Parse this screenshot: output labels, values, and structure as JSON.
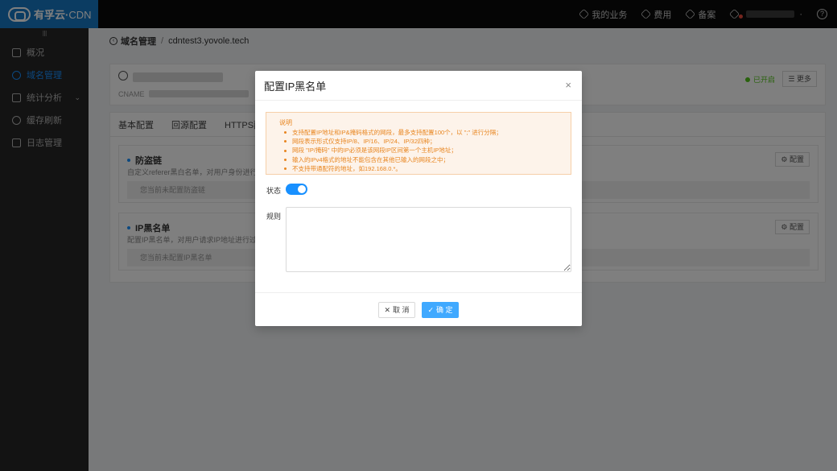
{
  "app": {
    "logo_brand": "有孚云",
    "logo_sep": "·",
    "logo_product": "CDN"
  },
  "topnav": {
    "items": [
      {
        "label": "我的业务",
        "icon": "business-icon"
      },
      {
        "label": "费用",
        "icon": "fee-icon"
      },
      {
        "label": "备案",
        "icon": "record-icon"
      }
    ],
    "help_glyph": "?",
    "user_caret": "·"
  },
  "sidebar": {
    "handle": "III",
    "items": [
      {
        "label": "概况",
        "icon": "overview-icon",
        "active": false
      },
      {
        "label": "域名管理",
        "icon": "domain-icon",
        "active": true
      },
      {
        "label": "统计分析",
        "icon": "stats-icon",
        "active": false,
        "caret": "⌄"
      },
      {
        "label": "缓存刷新",
        "icon": "refresh-icon",
        "active": false
      },
      {
        "label": "日志管理",
        "icon": "log-icon",
        "active": false
      }
    ]
  },
  "breadcrumb": {
    "back_glyph": "‹",
    "parent": "域名管理",
    "separator": "/",
    "current": "cdntest3.yovole.tech"
  },
  "domain_card": {
    "cname_label": "CNAME",
    "status": "已开启",
    "more_label": "☰ 更多"
  },
  "tabs": [
    "基本配置",
    "回源配置",
    "HTTPS配"
  ],
  "sections": [
    {
      "title": "防盗链",
      "desc": "自定义referer黑白名单，对用户身份进行识别",
      "empty": "您当前未配置防盗链",
      "config_label": "⚙ 配置"
    },
    {
      "title": "IP黑名单",
      "desc": "配置IP黑名单，对用户请求IP地址进行过滤。",
      "empty": "您当前未配置IP黑名单",
      "config_label": "⚙ 配置"
    }
  ],
  "modal": {
    "title": "配置IP黑名单",
    "close_glyph": "×",
    "notice_title": "说明",
    "notice_items": [
      "支持配置IP地址和IP&掩码格式的网段，最多支持配置100个，以 \";\" 进行分隔；",
      "网段表示形式仅支持IP/8、IP/16、IP/24、IP/32四种；",
      "网段 \"IP/掩码\" 中的IP必须是该网段IP区间第一个主机IP地址；",
      "输入的IPv4格式的地址不能包含在其他已输入的网段之中；",
      "不支持带通配符的地址，如192.168.0.*。"
    ],
    "status_label": "状态",
    "status_on": true,
    "rule_label": "规则",
    "rule_value": "",
    "cancel_label": "取 消",
    "cancel_glyph": "✕",
    "ok_label": "确 定",
    "ok_glyph": "✓"
  },
  "colors": {
    "primary": "#1890ff",
    "logo_bg": "#1778c4",
    "notice_text": "#e8851f",
    "notice_bg": "#fdf3ea",
    "success": "#52c41a"
  }
}
